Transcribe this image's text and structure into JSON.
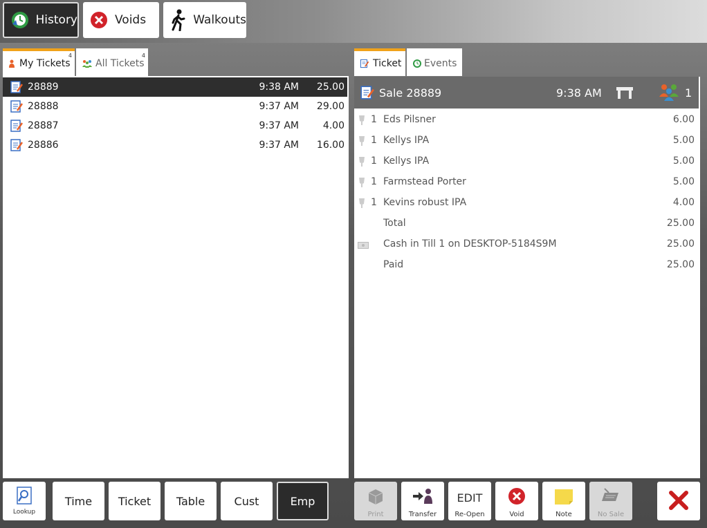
{
  "top_buttons": [
    {
      "label": "History"
    },
    {
      "label": "Voids"
    },
    {
      "label": "Walkouts"
    }
  ],
  "left_tabs": [
    {
      "label": "My Tickets",
      "count": "4"
    },
    {
      "label": "All Tickets",
      "count": "4"
    }
  ],
  "tickets": [
    {
      "number": "28889",
      "time": "9:38 AM",
      "amount": "25.00"
    },
    {
      "number": "28888",
      "time": "9:37 AM",
      "amount": "29.00"
    },
    {
      "number": "28887",
      "time": "9:37 AM",
      "amount": "4.00"
    },
    {
      "number": "28886",
      "time": "9:37 AM",
      "amount": "16.00"
    }
  ],
  "right_tabs": [
    {
      "label": "Ticket"
    },
    {
      "label": "Events"
    }
  ],
  "ticket_header": {
    "title": "Sale 28889",
    "time": "9:38 AM",
    "guests": "1"
  },
  "ticket_lines": [
    {
      "qty": "1",
      "desc": "Eds Pilsner",
      "price": "6.00"
    },
    {
      "qty": "1",
      "desc": "Kellys IPA",
      "price": "5.00"
    },
    {
      "qty": "1",
      "desc": "Kellys IPA",
      "price": "5.00"
    },
    {
      "qty": "1",
      "desc": "Farmstead Porter",
      "price": "5.00"
    },
    {
      "qty": "1",
      "desc": "Kevins  robust IPA",
      "price": "4.00"
    }
  ],
  "totals": {
    "total_label": "Total",
    "total_value": "25.00",
    "payment_label": "Cash in Till 1 on DESKTOP-5184S9M",
    "payment_value": "25.00",
    "paid_label": "Paid",
    "paid_value": "25.00"
  },
  "filter_buttons": {
    "lookup": "Lookup",
    "time": "Time",
    "ticket": "Ticket",
    "table": "Table",
    "cust": "Cust",
    "emp": "Emp"
  },
  "action_buttons": {
    "print": "Print",
    "transfer": "Transfer",
    "edit_top": "EDIT",
    "edit": "Re-Open",
    "void": "Void",
    "note": "Note",
    "nosale": "No Sale"
  },
  "colors": {
    "accent": "#f0a21a",
    "selected_row": "#2e2e2e",
    "void_red": "#d1232a"
  }
}
